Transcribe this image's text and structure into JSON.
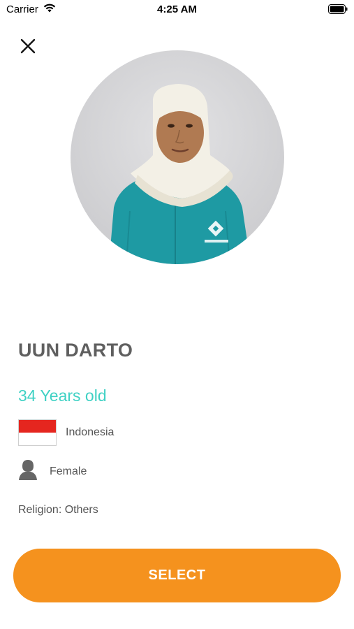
{
  "status_bar": {
    "carrier": "Carrier",
    "time": "4:25 AM"
  },
  "profile": {
    "name": "UUN DARTO",
    "age_text": "34 Years old",
    "country": "Indonesia",
    "gender": "Female",
    "religion": "Religion: Others",
    "photo_desc": "profile photo"
  },
  "actions": {
    "select_label": "SELECT"
  },
  "colors": {
    "accent_teal": "#3fd1c4",
    "button_orange": "#f5921e",
    "flag_red": "#e5261f"
  },
  "icons": [
    "wifi-icon",
    "battery-icon",
    "close-icon",
    "person-icon",
    "indonesia-flag-icon"
  ]
}
